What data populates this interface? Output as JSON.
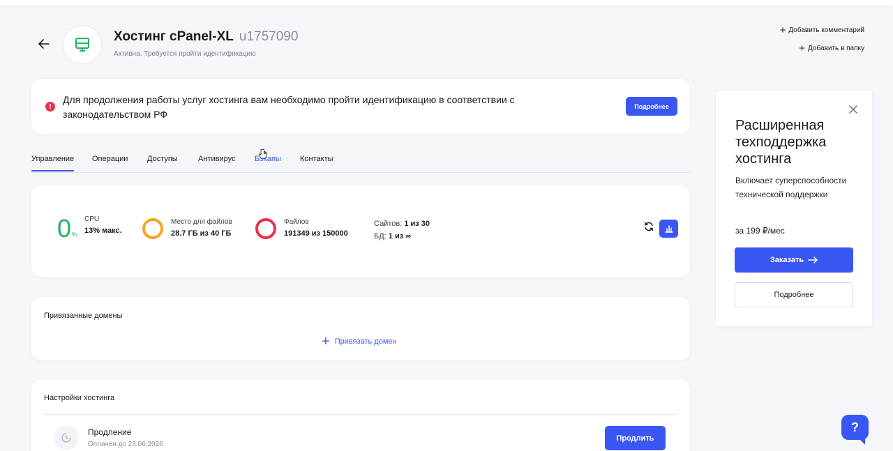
{
  "header": {
    "title": "Хостинг cPanel-XL",
    "login": "u1757090",
    "status": "Активна. Требуется пройти идентификацию",
    "actions": [
      {
        "label": "Добавить комментарий"
      },
      {
        "label": "Добавить в папку"
      }
    ]
  },
  "alert": {
    "text": "Для продолжения работы услуг хостинга вам необходимо пройти идентификацию в соответствии с законодательством РФ",
    "button": "Подробнее",
    "color": "#e8334a"
  },
  "tabs": [
    {
      "label": "Управление",
      "active": true
    },
    {
      "label": "Операции"
    },
    {
      "label": "Доступы"
    },
    {
      "label": "Антивирус"
    },
    {
      "label": "Бэкапы",
      "hover": true
    },
    {
      "label": "Контакты"
    }
  ],
  "resources": {
    "cpu": {
      "value": "0",
      "unit": "%",
      "label": "CPU",
      "detail": "13% макс."
    },
    "disk": {
      "label": "Место для файлов",
      "value": "28.7 ГБ из 40 ГБ",
      "color": "#f5a524"
    },
    "files": {
      "label": "Файлов",
      "value": "191349 из 150000",
      "color": "#e8334a"
    },
    "sites": {
      "label": "Сайтов:",
      "value": "1 из 30"
    },
    "db": {
      "label": "БД:",
      "value": "1 из ∞"
    }
  },
  "domains": {
    "title": "Привязанные домены",
    "add_label": "Привязать домен"
  },
  "settings": {
    "title": "Настройки хостинга",
    "renewal": {
      "title": "Продление",
      "paid_until": "Оплачен до 23.06.2026",
      "button": "Продлить"
    }
  },
  "promo": {
    "title": "Расширенная техподдержка хостинга",
    "description": "Включает суперспособности технической поддержки",
    "price": "за 199 ₽/мес",
    "order_button": "Заказать",
    "more_button": "Подробнее"
  },
  "help": {
    "label": "?"
  },
  "colors": {
    "accent": "#3a57f4",
    "success": "#22b266",
    "warning": "#f5a524",
    "danger": "#e8334a"
  }
}
